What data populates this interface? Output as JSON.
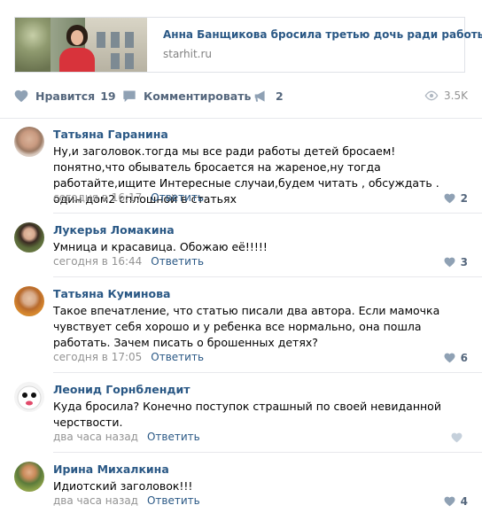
{
  "link_card": {
    "title": "Анна Банщикова бросила третью дочь ради работы",
    "domain": "starhit.ru"
  },
  "actions": {
    "like_label": "Нравится",
    "like_count": "19",
    "comment_label": "Комментировать",
    "share_count": "2",
    "views_count": "3.5K"
  },
  "comments": [
    {
      "author": "Татьяна Гаранина",
      "text": "Ну,и заголовок.тогда мы все ради работы детей бросаем! понятно,что обыватель бросается на жареное,ну тогда работайте,ищите Интересные случаи,будем читать , обсуждать . один дом2 сплошной в статьях",
      "time": "сегодня в 16:17",
      "reply_label": "Ответить",
      "likes": "2"
    },
    {
      "author": "Лукерья Ломакина",
      "text": "Умница и красавица. Обожаю её!!!!!",
      "time": "сегодня в 16:44",
      "reply_label": "Ответить",
      "likes": "3"
    },
    {
      "author": "Татьяна Куминова",
      "text": "Такое впечатление, что статью писали два автора. Если мамочка чувствует себя хорошо и у ребенка все нормально, она пошла работать. Зачем писать о брошенных детях?",
      "time": "сегодня в 17:05",
      "reply_label": "Ответить",
      "likes": "6"
    },
    {
      "author": "Леонид Горнблендит",
      "text": "Куда бросила? Конечно поступок страшный по своей невиданной черствости.",
      "time": "два часа назад",
      "reply_label": "Ответить",
      "likes": ""
    },
    {
      "author": "Ирина Михалкина",
      "text": "Идиотский заголовок!!!",
      "time": "два часа назад",
      "reply_label": "Ответить",
      "likes": "4"
    }
  ]
}
